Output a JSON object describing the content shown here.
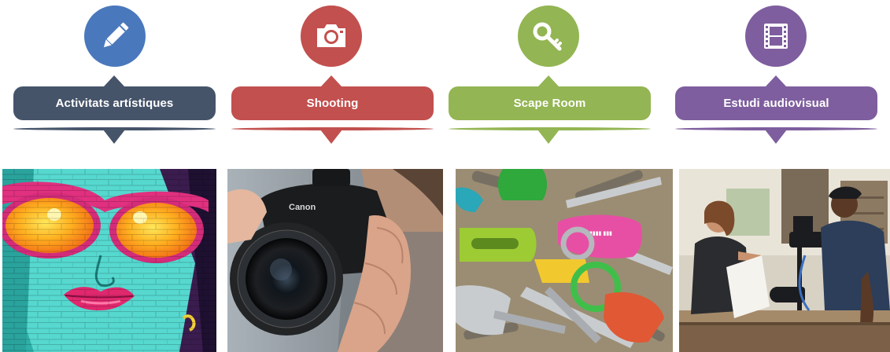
{
  "categories": [
    {
      "label": "Activitats artístiques",
      "color": "#46546A",
      "icon_color": "#4A78BC",
      "icon": "pencil-icon",
      "photo": "graffiti-face-photo"
    },
    {
      "label": "Shooting",
      "color": "#C2504E",
      "icon_color": "#C2504E",
      "icon": "camera-icon",
      "photo": "camera-photo"
    },
    {
      "label": "Scape Room",
      "color": "#93B553",
      "icon_color": "#93B553",
      "icon": "key-icon",
      "photo": "keys-photo"
    },
    {
      "label": "Estudi audiovisual",
      "color": "#7E5E9E",
      "icon_color": "#7E5E9E",
      "icon": "film-icon",
      "photo": "film-studio-photo"
    }
  ],
  "photos": {
    "camera_brand": "Canon"
  }
}
